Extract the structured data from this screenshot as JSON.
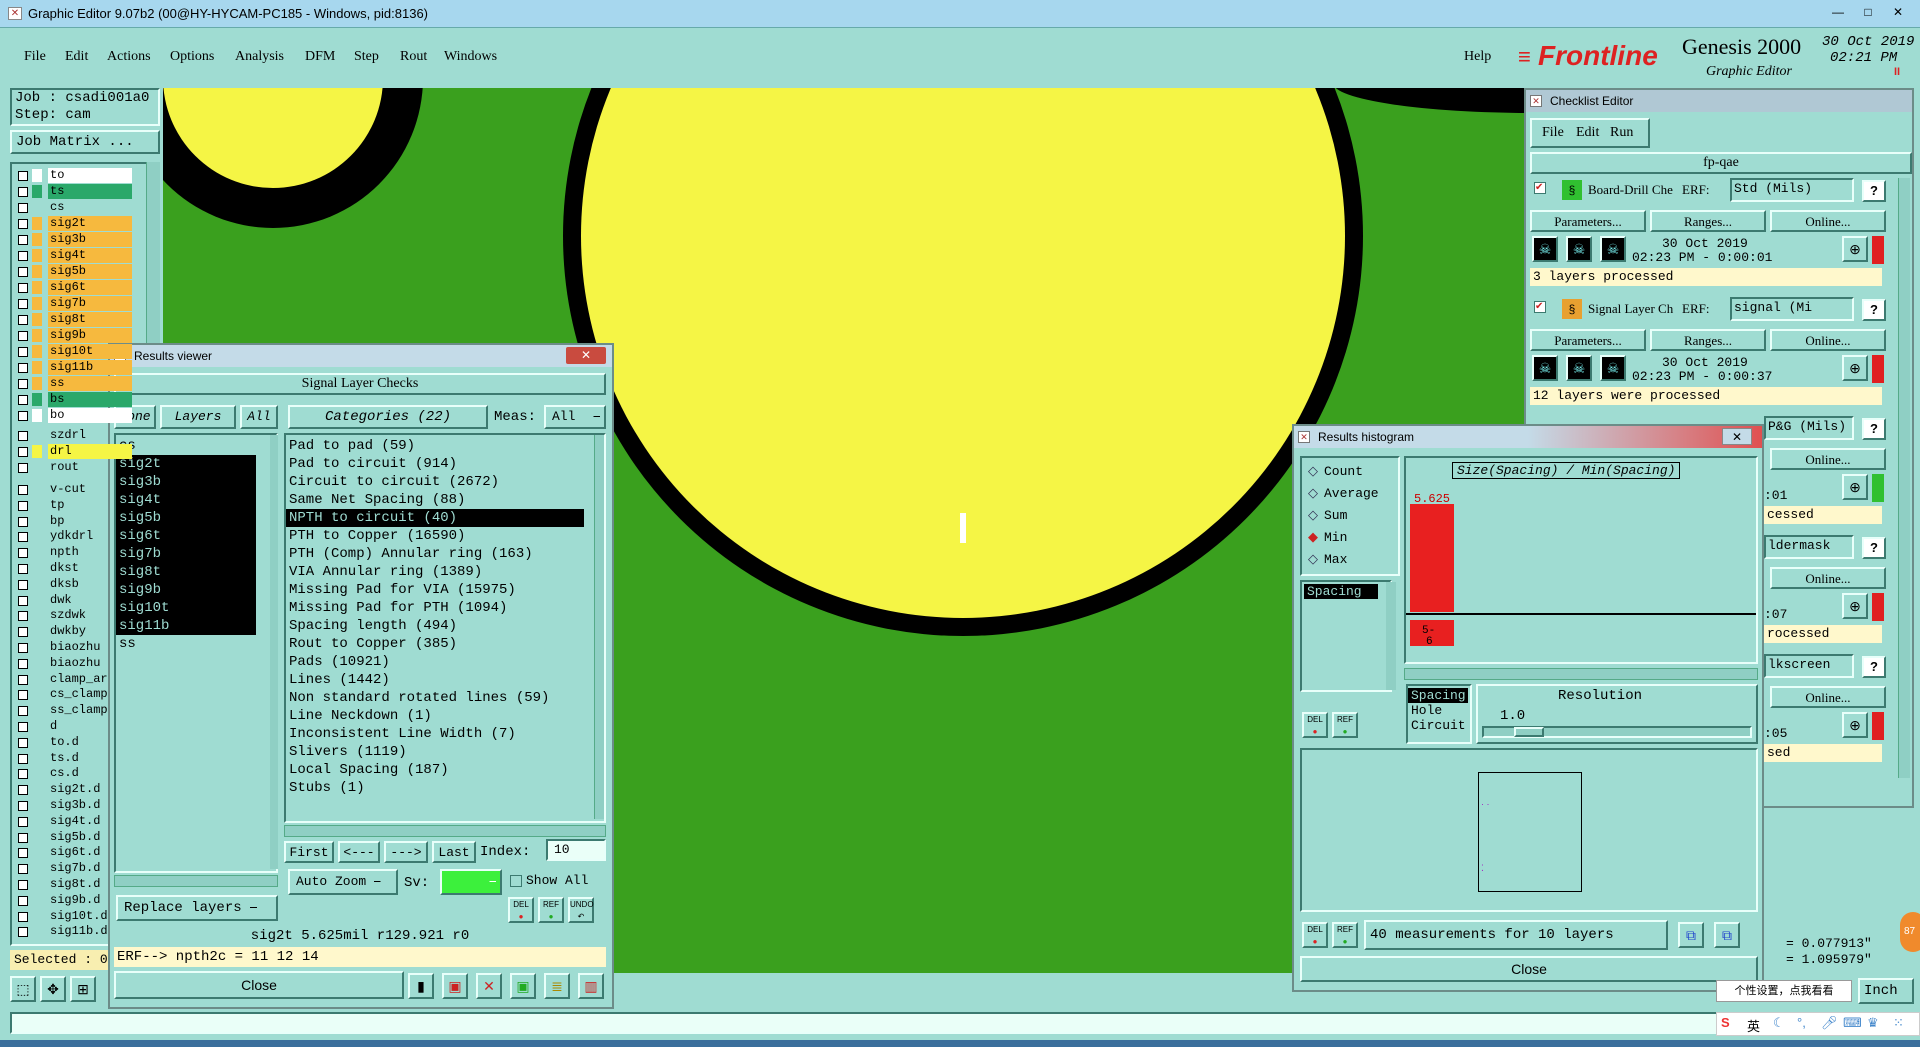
{
  "window": {
    "title": "Graphic Editor 9.07b2 (00@HY-HYCAM-PC185 - Windows, pid:8136)"
  },
  "menu": {
    "items": [
      "File",
      "Edit",
      "Actions",
      "Options",
      "Analysis",
      "DFM",
      "Step",
      "Rout",
      "Windows"
    ],
    "help": "Help"
  },
  "brand": {
    "logo": "Frontline",
    "product": "Genesis 2000",
    "subtitle": "Graphic Editor",
    "date": "30 Oct 2019",
    "time": "02:21 PM"
  },
  "job": {
    "job_label": "Job : csadi001a0",
    "step_label": "Step: cam",
    "matrix_button": "Job Matrix ..."
  },
  "layers": [
    {
      "name": "to",
      "color": "#ffffff",
      "sel": true
    },
    {
      "name": "ts",
      "color": "#2aa86a"
    },
    {
      "name": "cs",
      "color": "#9fdcd2"
    },
    {
      "name": "sig2t",
      "color": "#f6b93e"
    },
    {
      "name": "sig3b",
      "color": "#f6b93e"
    },
    {
      "name": "sig4t",
      "color": "#f6b93e"
    },
    {
      "name": "sig5b",
      "color": "#f6b93e"
    },
    {
      "name": "sig6t",
      "color": "#f6b93e"
    },
    {
      "name": "sig7b",
      "color": "#f6b93e"
    },
    {
      "name": "sig8t",
      "color": "#f6b93e"
    },
    {
      "name": "sig9b",
      "color": "#f6b93e"
    },
    {
      "name": "sig10t",
      "color": "#f6b93e"
    },
    {
      "name": "sig11b",
      "color": "#f6b93e"
    },
    {
      "name": "ss",
      "color": "#f6b93e"
    },
    {
      "name": "bs",
      "color": "#2aa86a"
    },
    {
      "name": "bo",
      "color": "#ffffff"
    }
  ],
  "drill_layers": [
    {
      "name": "szdrl"
    },
    {
      "name": "drl"
    },
    {
      "name": "rout"
    }
  ],
  "doc_layers": [
    "v-cut",
    "tp",
    "bp",
    "ydkdrl",
    "npth",
    "dkst",
    "dksb",
    "dwk",
    "szdwk",
    "dwkby",
    "biaozhu",
    "biaozhu",
    "clamp_ar",
    "cs_clamp",
    "ss_clamp",
    "d",
    "to.d",
    "ts.d",
    "cs.d",
    "sig2t.d",
    "sig3b.d",
    "sig4t.d",
    "sig5b.d",
    "sig6t.d",
    "sig7b.d",
    "sig8t.d",
    "sig9b.d",
    "sig10t.d",
    "sig11b.d"
  ],
  "selected_label": "Selected : 0",
  "results_viewer": {
    "title": "Results viewer",
    "header": "Signal Layer Checks",
    "none_btn": "None",
    "layers_btn": "Layers",
    "all_btn": "All",
    "categories_btn": "Categories (22)",
    "meas_label": "Meas:",
    "meas_value": "All",
    "layer_list": [
      "cs",
      "sig2t",
      "sig3b",
      "sig4t",
      "sig5b",
      "sig6t",
      "sig7b",
      "sig8t",
      "sig9b",
      "sig10t",
      "sig11b",
      "ss"
    ],
    "categories": [
      "Pad to pad (59)",
      "Pad to circuit (914)",
      "Circuit to circuit (2672)",
      "Same Net Spacing (88)",
      "NPTH to circuit (40)",
      "PTH to Copper (16590)",
      "PTH (Comp) Annular ring (163)",
      "VIA Annular ring (1389)",
      "Missing Pad for VIA (15975)",
      "Missing Pad for PTH (1094)",
      "Spacing length (494)",
      "Rout to Copper (385)",
      "Pads (10921)",
      "Lines (1442)",
      "Non standard rotated lines (59)",
      "Line Neckdown (1)",
      "Inconsistent Line Width (7)",
      "Slivers (1119)",
      "Local Spacing (187)",
      "Stubs (1)"
    ],
    "selected_category": "NPTH to circuit (40)",
    "first": "First",
    "prev": "<---",
    "next": "--->",
    "last": "Last",
    "index_label": "Index:",
    "index_value": "10",
    "autozoom": "Auto Zoom",
    "sv_label": "Sv:",
    "show_all": "Show All",
    "replace_layers": "Replace layers",
    "del": "DEL",
    "ref": "REF",
    "undo": "UNDO",
    "status": "sig2t 5.625mil  r129.921  r0",
    "erf": "ERF--> npth2c = 11 12 14",
    "close": "Close"
  },
  "checklist": {
    "title": "Checklist Editor",
    "menu": [
      "File",
      "Edit",
      "Run"
    ],
    "name": "fp-qae",
    "params": "Parameters...",
    "ranges": "Ranges...",
    "online": "Online...",
    "checks": [
      {
        "name": "Board-Drill Che",
        "erf": "ERF:",
        "erf_value": "Std (Mils)",
        "date": "30 Oct 2019",
        "time": "02:23 PM - 0:00:01",
        "status": "3 layers processed",
        "icon_color": "#30c030"
      },
      {
        "name": "Signal Layer Ch",
        "erf": "ERF:",
        "erf_value": "signal (Mi",
        "date": "30 Oct 2019",
        "time": "02:23 PM - 0:00:37",
        "status": "12 layers were processed",
        "icon_color": "#e8a030"
      },
      {
        "erf_value": "P&G (Mils)",
        "time": ":01",
        "status": "cessed"
      },
      {
        "erf_value": "ldermask",
        "time": ":07",
        "status": "rocessed"
      },
      {
        "erf_value": "lkscreen",
        "time": ":05",
        "status": "sed"
      }
    ]
  },
  "histogram": {
    "title": "Results histogram",
    "modes": [
      "Count",
      "Average",
      "Sum",
      "Min",
      "Max"
    ],
    "selected_mode": "Min",
    "chart_title": "Size(Spacing) / Min(Spacing)",
    "bar_value_label": "5.625",
    "bar_bin_label": "5-\n6",
    "list_item": "Spacing",
    "types": [
      "Spacing",
      "Hole",
      "Circuit"
    ],
    "resolution_label": "Resolution",
    "resolution_value": "1.0",
    "del": "DEL",
    "ref": "REF",
    "summary": "40 measurements for 10 layers",
    "close": "Close"
  },
  "coords": {
    "x": "= 0.077913\"",
    "y": "= 1.095979\""
  },
  "units": "Inch",
  "tooltip": "个性设置，点我看看",
  "ime": "英"
}
